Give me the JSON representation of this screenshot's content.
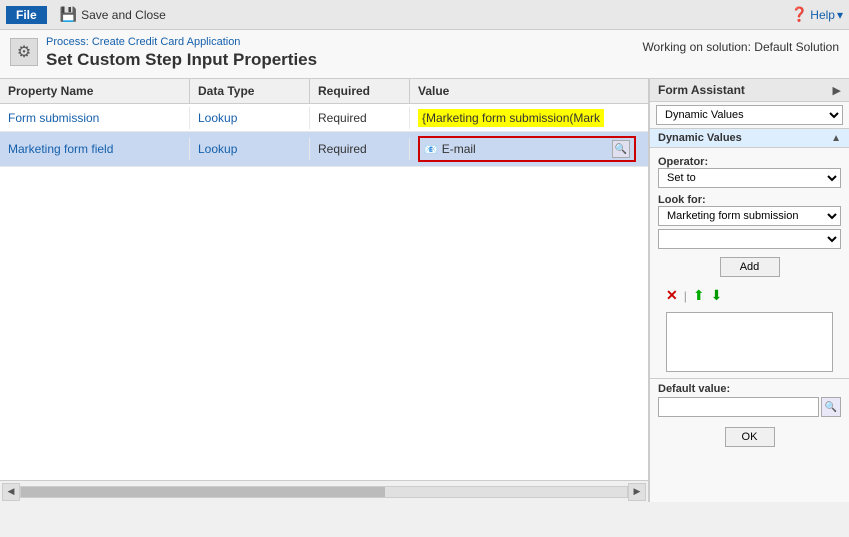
{
  "topbar": {
    "file_label": "File",
    "save_close_label": "Save and Close",
    "help_label": "Help"
  },
  "header": {
    "breadcrumb": "Process: Create Credit Card Application",
    "title": "Set Custom Step Input Properties",
    "working_on": "Working on solution: Default Solution"
  },
  "table": {
    "columns": [
      "Property Name",
      "Data Type",
      "Required",
      "Value"
    ],
    "rows": [
      {
        "property": "Form submission",
        "data_type": "Lookup",
        "required": "Required",
        "value": "{Marketing form submission(Mark"
      },
      {
        "property": "Marketing form field",
        "data_type": "Lookup",
        "required": "Required",
        "value": "E-mail"
      }
    ]
  },
  "right_panel": {
    "title": "Form Assistant",
    "dynamic_values_label": "Dynamic Values",
    "operator_label": "Operator:",
    "operator_value": "Set to",
    "look_for_label": "Look for:",
    "look_for_value": "Marketing form submission",
    "add_button": "Add",
    "default_value_label": "Default value:",
    "ok_button": "OK",
    "dropdown_options": [
      "Dynamic Values"
    ],
    "look_for_options": [
      "Marketing form submission"
    ],
    "second_dropdown_options": [
      ""
    ]
  }
}
